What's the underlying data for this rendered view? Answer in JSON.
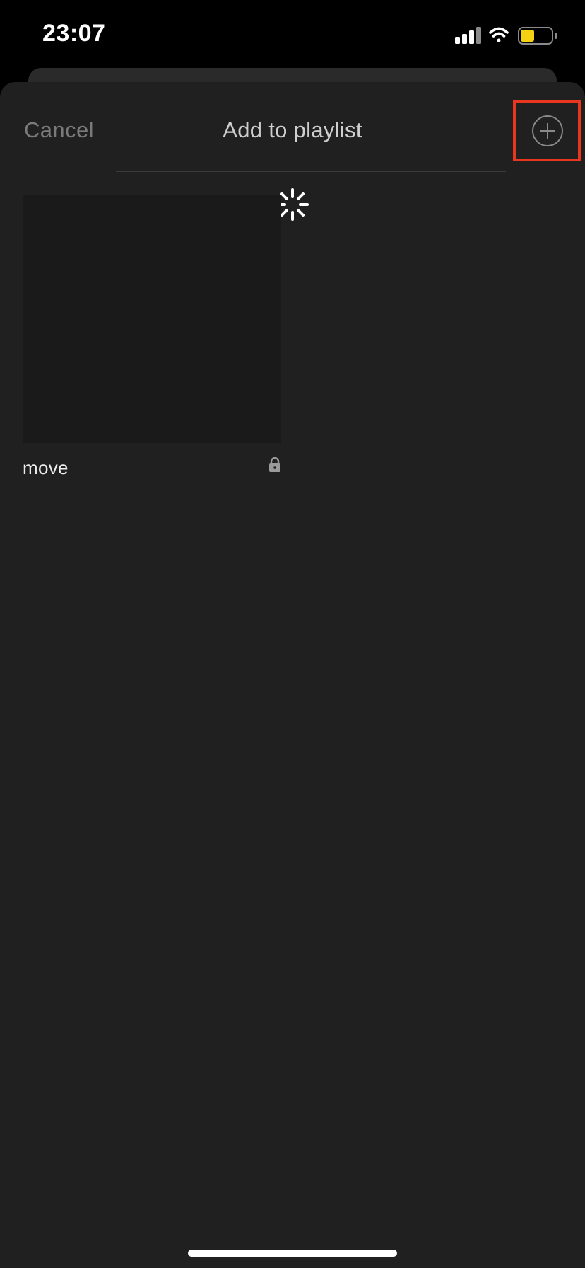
{
  "status_bar": {
    "time": "23:07",
    "battery_color": "#f5d113",
    "icons": [
      "cellular-signal-icon",
      "wifi-icon",
      "battery-icon"
    ]
  },
  "sheet": {
    "cancel_label": "Cancel",
    "title": "Add to playlist",
    "add_icon": "plus-circle-icon",
    "highlight_color": "#e8361f",
    "loading_icon": "spinner-icon"
  },
  "playlists": [
    {
      "name": "move",
      "private_icon": "lock-icon"
    }
  ]
}
